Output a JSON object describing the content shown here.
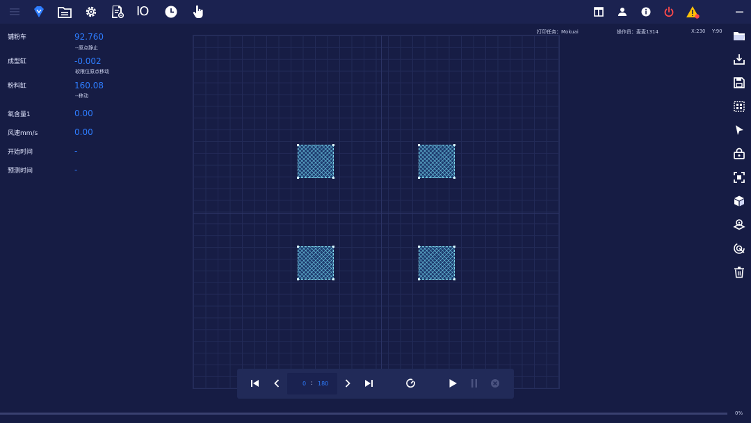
{
  "toolbar": {
    "icons": [
      "menu-icon",
      "gem-icon",
      "folder-list-icon",
      "gear-icon",
      "document-settings-icon",
      "io-icon",
      "clock-icon",
      "hand-pointer-icon"
    ],
    "io_label": "IO",
    "right_icons": [
      "layout-icon",
      "user-icon",
      "info-icon",
      "power-icon",
      "warning-icon",
      "minimize-icon"
    ],
    "accent": "#2e7dff",
    "power_color": "#ff4a4a",
    "warning_color": "#ffc107"
  },
  "status": {
    "recoater_label": "铺粉车",
    "recoater_value": "92.760",
    "recoater_state": "--原点静止",
    "build_label": "成型缸",
    "build_value": "-0.002",
    "build_state": "软限位原点移动",
    "powder_label": "粉料缸",
    "powder_value": "160.08",
    "powder_state": "--移动",
    "oxygen_label": "氧含量1",
    "oxygen_value": "0.00",
    "wind_label": "风速mm/s",
    "wind_value": "0.00",
    "start_label": "开始时间",
    "start_value": "-",
    "eta_label": "预测时间",
    "eta_value": "-"
  },
  "job": {
    "task": "打印任务：Mokuai",
    "operator": "操作员：麦麦1314",
    "x": "X:230",
    "y": "Y:90"
  },
  "player": {
    "current_layer": "0",
    "separator": ":",
    "total_layers": "180"
  },
  "progress": {
    "value": 0,
    "label": "0%"
  },
  "right_toolbar": [
    "open-folder-icon",
    "import-icon",
    "save-icon",
    "select-region-icon",
    "pointer-icon",
    "lock-icon",
    "fit-view-icon",
    "cube-icon",
    "layers-support-icon",
    "scan-icon",
    "trash-icon"
  ]
}
